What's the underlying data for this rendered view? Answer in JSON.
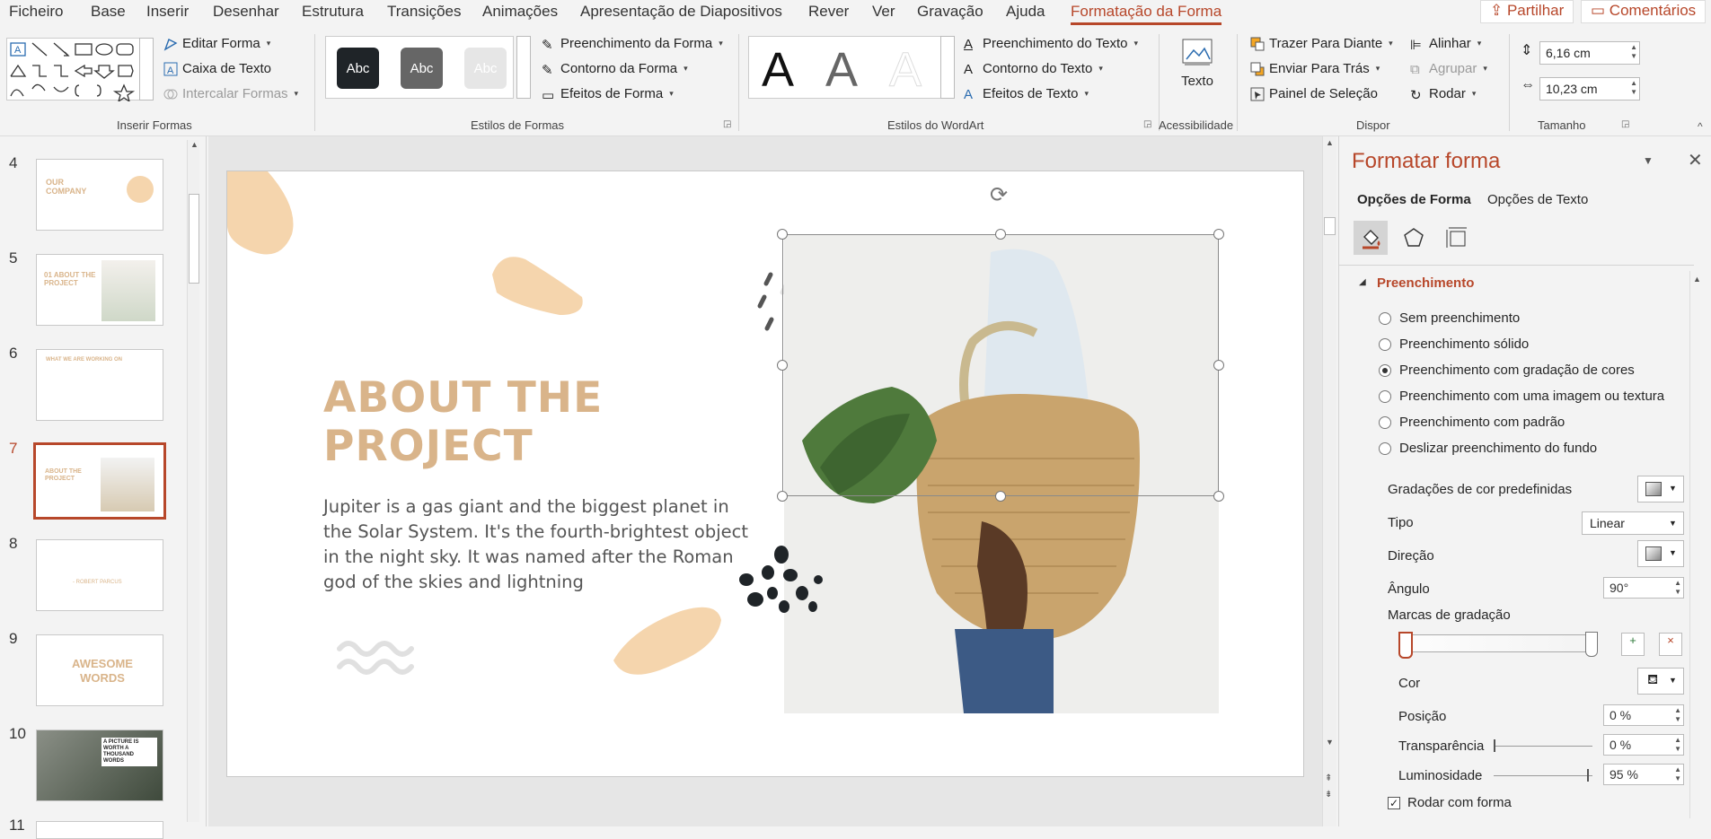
{
  "menu": {
    "tabs": [
      "Ficheiro",
      "Base",
      "Inserir",
      "Desenhar",
      "Estrutura",
      "Transições",
      "Animações",
      "Apresentação de Diapositivos",
      "Rever",
      "Ver",
      "Gravação",
      "Ajuda",
      "Formatação da Forma"
    ],
    "share": "Partilhar",
    "comments": "Comentários"
  },
  "ribbon": {
    "insert_shapes": {
      "edit_shape": "Editar Forma",
      "text_box": "Caixa de Texto",
      "merge_shapes": "Intercalar Formas",
      "label": "Inserir Formas"
    },
    "shape_styles": {
      "style_sample": "Abc",
      "fill": "Preenchimento da Forma",
      "outline": "Contorno da Forma",
      "effects": "Efeitos de Forma",
      "label": "Estilos de Formas"
    },
    "wordart": {
      "sample": "A",
      "text_fill": "Preenchimento do Texto",
      "text_outline": "Contorno do Texto",
      "text_effects": "Efeitos de Texto",
      "label": "Estilos do WordArt"
    },
    "accessibility": {
      "alt_text": "Texto",
      "label": "Acessibilidade"
    },
    "arrange": {
      "bring_forward": "Trazer Para Diante",
      "send_backward": "Enviar Para Trás",
      "selection_pane": "Painel de Seleção",
      "align": "Alinhar",
      "group": "Agrupar",
      "rotate": "Rodar",
      "label": "Dispor"
    },
    "size": {
      "height": "6,16 cm",
      "width": "10,23 cm",
      "label": "Tamanho"
    }
  },
  "thumbnails": [
    {
      "num": "4",
      "title": "OUR COMPANY"
    },
    {
      "num": "5",
      "title": "01 ABOUT THE PROJECT"
    },
    {
      "num": "6",
      "title": "WHAT WE ARE WORKING ON"
    },
    {
      "num": "7",
      "title": "ABOUT THE PROJECT"
    },
    {
      "num": "8",
      "title": "- ROBERT PARCUS"
    },
    {
      "num": "9",
      "title": "AWESOME WORDS"
    },
    {
      "num": "10",
      "title": "A PICTURE IS WORTH A THOUSAND WORDS"
    },
    {
      "num": "11",
      "title": ""
    }
  ],
  "slide": {
    "title_line1": "ABOUT THE",
    "title_line2": "PROJECT",
    "body_line1": "Jupiter is a gas giant and the biggest planet in",
    "body_line2": "the Solar System. It's the fourth-brightest object",
    "body_line3": "in the night sky. It was named after the Roman",
    "body_line4": "god of the skies and lightning"
  },
  "format_pane": {
    "title": "Formatar forma",
    "tab_shape": "Opções de Forma",
    "tab_text": "Opções de Texto",
    "section": "Preenchimento",
    "fill_options": [
      "Sem preenchimento",
      "Preenchimento sólido",
      "Preenchimento com gradação de cores",
      "Preenchimento com uma imagem ou textura",
      "Preenchimento com padrão",
      "Deslizar preenchimento do fundo"
    ],
    "selected_fill": 2,
    "preset_gradients": "Gradações de cor predefinidas",
    "type_label": "Tipo",
    "type_value": "Linear",
    "direction_label": "Direção",
    "angle_label": "Ângulo",
    "angle_value": "90°",
    "stops_label": "Marcas de gradação",
    "color_label": "Cor",
    "position_label": "Posição",
    "position_value": "0 %",
    "transparency_label": "Transparência",
    "transparency_value": "0 %",
    "luminosity_label": "Luminosidade",
    "luminosity_value": "95 %",
    "rotate_with_shape": "Rodar com forma"
  },
  "colors": {
    "accent": "#b7472a",
    "slide_title": "#d9b48a",
    "blob": "#f5d5ad"
  }
}
